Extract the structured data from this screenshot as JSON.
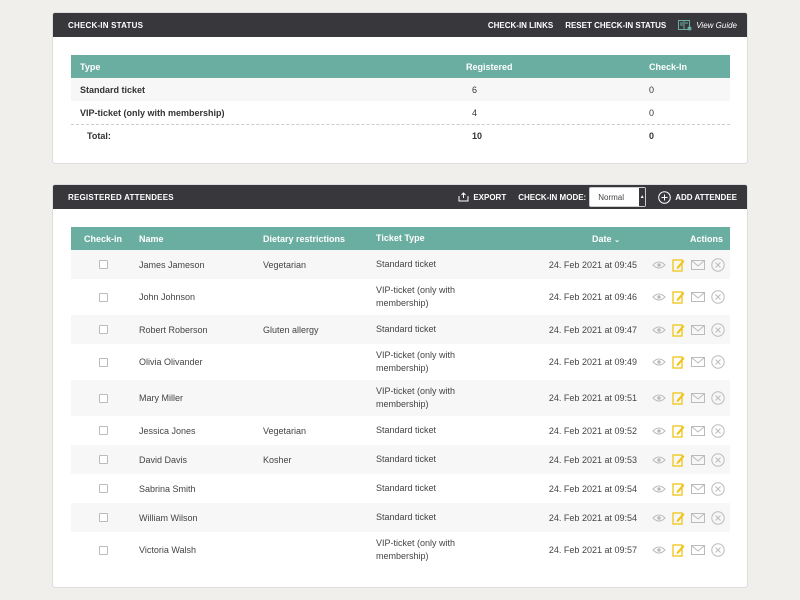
{
  "checkin_status": {
    "title": "CHECK-IN STATUS",
    "links_label": "CHECK-IN LINKS",
    "reset_label": "RESET CHECK-IN STATUS",
    "guide_label": "View Guide",
    "columns": {
      "type": "Type",
      "registered": "Registered",
      "checkin": "Check-In"
    },
    "rows": [
      {
        "type": "Standard ticket",
        "registered": "6",
        "checkin": "0"
      },
      {
        "type": "VIP-ticket (only with membership)",
        "registered": "4",
        "checkin": "0"
      }
    ],
    "total": {
      "label": "Total:",
      "registered": "10",
      "checkin": "0"
    }
  },
  "attendees": {
    "title": "REGISTERED ATTENDEES",
    "export_label": "EXPORT",
    "mode_label": "CHECK-IN MODE:",
    "mode_value": "Normal",
    "add_label": "ADD ATTENDEE",
    "columns": {
      "checkin": "Check-in",
      "name": "Name",
      "diet": "Dietary restrictions",
      "ticket": "Ticket Type",
      "date": "Date",
      "actions": "Actions"
    },
    "rows": [
      {
        "name": "James Jameson",
        "diet": "Vegetarian",
        "ticket": "Standard ticket",
        "date": "24. Feb 2021 at 09:45"
      },
      {
        "name": "John Johnson",
        "diet": "",
        "ticket": "VIP-ticket (only with membership)",
        "date": "24. Feb 2021 at 09:46"
      },
      {
        "name": "Robert Roberson",
        "diet": "Gluten allergy",
        "ticket": "Standard ticket",
        "date": "24. Feb 2021 at 09:47"
      },
      {
        "name": "Olivia Olivander",
        "diet": "",
        "ticket": "VIP-ticket (only with membership)",
        "date": "24. Feb 2021 at 09:49"
      },
      {
        "name": "Mary Miller",
        "diet": "",
        "ticket": "VIP-ticket (only with membership)",
        "date": "24. Feb 2021 at 09:51"
      },
      {
        "name": "Jessica Jones",
        "diet": "Vegetarian",
        "ticket": "Standard ticket",
        "date": "24. Feb 2021 at 09:52"
      },
      {
        "name": "David Davis",
        "diet": "Kosher",
        "ticket": "Standard ticket",
        "date": "24. Feb 2021 at 09:53"
      },
      {
        "name": "Sabrina Smith",
        "diet": "",
        "ticket": "Standard ticket",
        "date": "24. Feb 2021 at 09:54"
      },
      {
        "name": "William Wilson",
        "diet": "",
        "ticket": "Standard ticket",
        "date": "24. Feb 2021 at 09:54"
      },
      {
        "name": "Victoria Walsh",
        "diet": "",
        "ticket": "VIP-ticket (only with membership)",
        "date": "24. Feb 2021 at 09:57"
      }
    ]
  },
  "colors": {
    "header_dark": "#38373c",
    "table_header": "#6aaea1",
    "edit_icon": "#f0c419"
  },
  "icons": {
    "guide": "guide-book-icon",
    "export": "export-icon",
    "add": "plus-circle-icon",
    "view": "eye-icon",
    "edit": "edit-icon",
    "mail": "mail-icon",
    "delete": "close-circle-icon",
    "sort": "chevron-down-icon"
  }
}
